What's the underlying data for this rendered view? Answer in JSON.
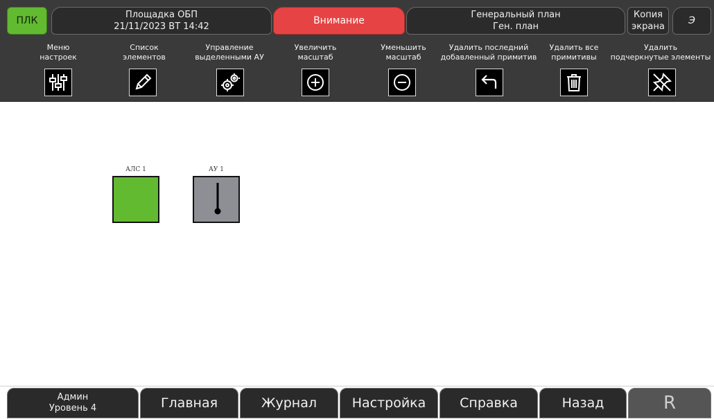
{
  "header": {
    "plk": "ПЛК",
    "site_name": "Площадка ОБП",
    "datetime": "21/11/2023 ВТ 14:42",
    "alert": "Внимание",
    "plan_title": "Генеральный план",
    "plan_short": "Ген. план",
    "copy_line1": "Копия",
    "copy_line2": "экрана",
    "e_button": "Э"
  },
  "toolbar": [
    {
      "line1": "Меню",
      "line2": "настроек",
      "icon": "sliders-icon"
    },
    {
      "line1": "Список",
      "line2": "элементов",
      "icon": "pencil-icon"
    },
    {
      "line1": "Управление",
      "line2": "выделенными АУ",
      "icon": "gears-icon"
    },
    {
      "line1": "Увеличить",
      "line2": "масштаб",
      "icon": "zoom-in-icon"
    },
    {
      "line1": "Уменьшить",
      "line2": "масштаб",
      "icon": "zoom-out-icon"
    },
    {
      "line1": "Удалить последний",
      "line2": "добавленный примитив",
      "icon": "undo-arrow-icon"
    },
    {
      "line1": "Удалить все",
      "line2": "примитивы",
      "icon": "trash-icon"
    },
    {
      "line1": "Удалить",
      "line2": "подчеркнутые элементы",
      "icon": "pin-off-icon"
    }
  ],
  "canvas": {
    "elements": [
      {
        "label": "АЛС 1",
        "color": "#62ba30"
      },
      {
        "label": "АУ 1",
        "color": "#8e8e95"
      }
    ]
  },
  "footer": {
    "user_role": "Админ",
    "user_level": "Уровень 4",
    "tabs": [
      "Главная",
      "Журнал",
      "Настройка",
      "Справка",
      "Назад"
    ],
    "r_button": "R"
  },
  "colors": {
    "ok_green": "#62ba30",
    "alert_red": "#e64444",
    "bar_dark": "#3a3a3a"
  }
}
